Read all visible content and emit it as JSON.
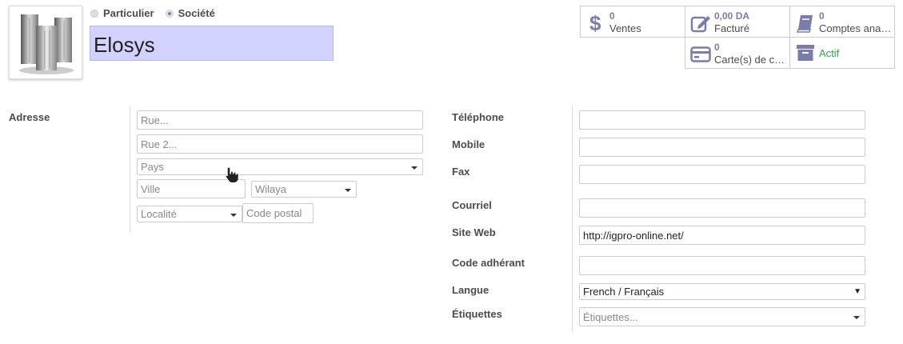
{
  "company_type": {
    "options": [
      {
        "label": "Particulier",
        "checked": false
      },
      {
        "label": "Société",
        "checked": true
      }
    ]
  },
  "partner": {
    "name": "Elosys",
    "avatar_icon": "building-icon"
  },
  "stats": {
    "sales": {
      "value": "0",
      "label": "Ventes",
      "icon": "dollar-icon"
    },
    "invoiced": {
      "value": "0,00 DA",
      "label": "Facturé",
      "icon": "pencil-square-icon"
    },
    "analytic": {
      "value": "0",
      "label": "Comptes ana…",
      "icon": "book-icon"
    },
    "cards": {
      "value": "0",
      "label": "Carte(s) de c…",
      "icon": "credit-card-icon"
    },
    "active": {
      "label": "Actif",
      "icon": "archive-icon",
      "color": "#28a745"
    }
  },
  "address": {
    "label": "Adresse",
    "street_placeholder": "Rue...",
    "street2_placeholder": "Rue 2...",
    "country_placeholder": "Pays",
    "city_placeholder": "Ville",
    "state_placeholder": "Wilaya",
    "locality_placeholder": "Localité",
    "zip_placeholder": "Code postal"
  },
  "contact": {
    "phone_label": "Téléphone",
    "phone_value": "",
    "mobile_label": "Mobile",
    "mobile_value": "",
    "fax_label": "Fax",
    "fax_value": "",
    "email_label": "Courriel",
    "email_value": "",
    "website_label": "Site Web",
    "website_value": "http://igpro-online.net/",
    "member_code_label": "Code adhérant",
    "member_code_value": "",
    "lang_label": "Langue",
    "lang_value": "French / Français",
    "tags_label": "Étiquettes",
    "tags_placeholder": "Étiquettes..."
  },
  "colors": {
    "accent": "#7c7bad",
    "name_bg": "#d2d2ff",
    "active_green": "#28a745"
  }
}
